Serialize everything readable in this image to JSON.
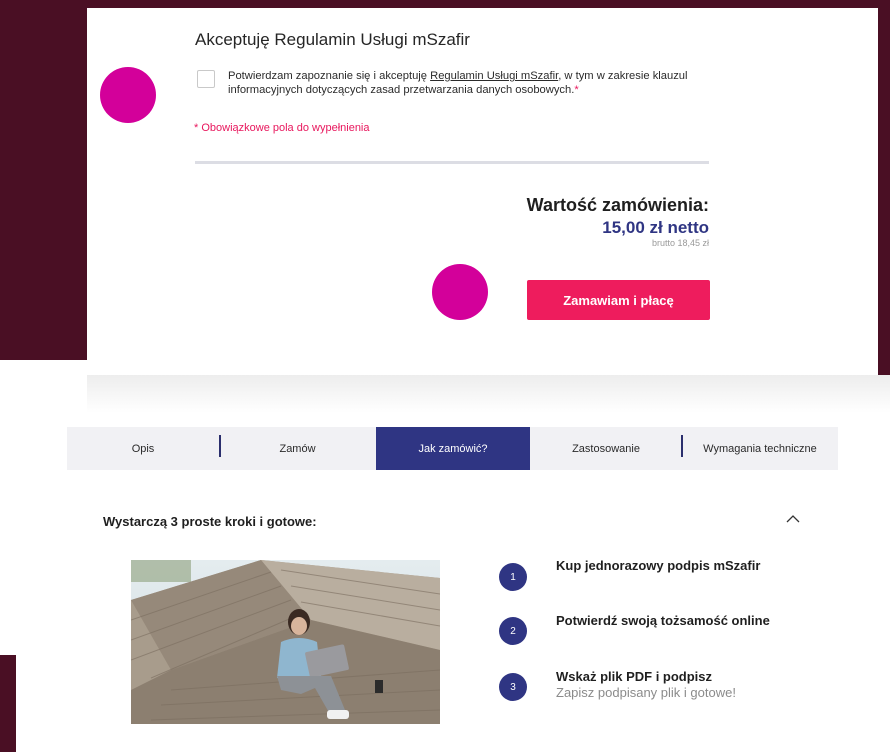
{
  "terms": {
    "title": "Akceptuję Regulamin Usługi mSzafir",
    "consent_before": "Potwierdzam zapoznanie się i akceptuję ",
    "consent_link": "Regulamin Usługi mSzafir",
    "consent_after": ", w tym w zakresie klauzul informacyjnych dotyczących zasad przetwarzania danych osobowych.",
    "required_mark": "*",
    "required_note": "* Obowiązkowe pola do wypełnienia",
    "checked": false
  },
  "order": {
    "label": "Wartość zamówienia:",
    "net": "15,00 zł netto",
    "gross": "brutto 18,45 zł",
    "button": "Zamawiam i płacę"
  },
  "tabs": [
    {
      "label": "Opis"
    },
    {
      "label": "Zamów"
    },
    {
      "label": "Jak zamówić?"
    },
    {
      "label": "Zastosowanie"
    },
    {
      "label": "Wymagania techniczne"
    }
  ],
  "active_tab": "Jak zamówić?",
  "steps": {
    "title": "Wystarczą 3 proste kroki i gotowe:",
    "collapse_icon": "chevron-up-icon",
    "items": [
      {
        "num": "1",
        "title": "Kup jednorazowy podpis mSzafir",
        "sub": ""
      },
      {
        "num": "2",
        "title": "Potwierdź swoją tożsamość online",
        "sub": ""
      },
      {
        "num": "3",
        "title": "Wskaż plik PDF i podpisz",
        "sub": "Zapisz podpisany plik i gotowe!"
      }
    ]
  },
  "colors": {
    "maroon": "#4a0f24",
    "accent_pink": "#ee1c5d",
    "navy": "#2f3583",
    "marker": "#d3009a"
  }
}
